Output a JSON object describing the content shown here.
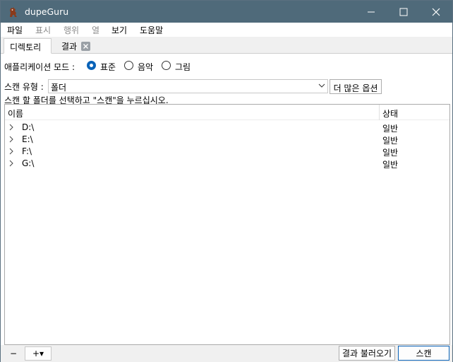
{
  "window": {
    "title": "dupeGuru"
  },
  "menu": {
    "items": [
      {
        "label": "파일",
        "enabled": true
      },
      {
        "label": "표시",
        "enabled": false
      },
      {
        "label": "행위",
        "enabled": false
      },
      {
        "label": "열",
        "enabled": false
      },
      {
        "label": "보기",
        "enabled": true
      },
      {
        "label": "도움말",
        "enabled": true
      }
    ]
  },
  "tabs": [
    {
      "label": "디렉토리",
      "active": true
    },
    {
      "label": "결과",
      "active": false,
      "closable": true
    }
  ],
  "mode": {
    "label": "애플리케이션 모드 :",
    "options": [
      {
        "label": "표준",
        "checked": true
      },
      {
        "label": "음악",
        "checked": false
      },
      {
        "label": "그림",
        "checked": false
      }
    ]
  },
  "scan_type": {
    "label": "스캔 유형 :",
    "selected": "폴더",
    "more_options_label": "더 많은 옵션"
  },
  "hint": "스캔 할 폴더를 선택하고 \"스캔\"을 누르십시오.",
  "tree": {
    "columns": {
      "name": "이름",
      "state": "상태"
    },
    "rows": [
      {
        "path": "D:\\",
        "state": "일반"
      },
      {
        "path": "E:\\",
        "state": "일반"
      },
      {
        "path": "F:\\",
        "state": "일반"
      },
      {
        "path": "G:\\",
        "state": "일반"
      }
    ]
  },
  "bottom": {
    "remove_label": "−",
    "add_label": "+▾",
    "load_results_label": "결과 불러오기",
    "scan_label": "스캔"
  },
  "icons": {
    "app": "dupeguru-app-icon",
    "minimize": "minimize-icon",
    "maximize": "maximize-icon",
    "close": "close-icon",
    "tab_close": "tab-close-icon",
    "combo_arrow": "chevron-down-icon",
    "expand": "chevron-right-icon"
  },
  "colors": {
    "titlebar": "#4f6a7a",
    "accent": "#0a63b8"
  }
}
